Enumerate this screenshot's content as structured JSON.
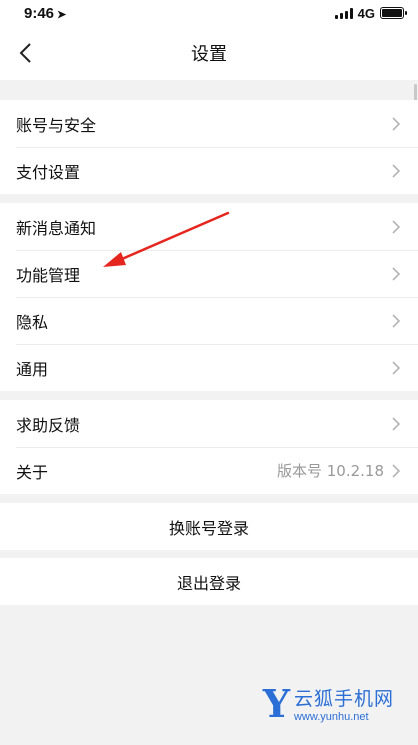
{
  "status_bar": {
    "time": "9:46",
    "location_icon": "location-arrow-icon",
    "network": "4G"
  },
  "nav": {
    "title": "设置"
  },
  "sections": [
    {
      "items": [
        {
          "label": "账号与安全"
        },
        {
          "label": "支付设置"
        }
      ]
    },
    {
      "items": [
        {
          "label": "新消息通知"
        },
        {
          "label": "功能管理"
        },
        {
          "label": "隐私"
        },
        {
          "label": "通用"
        }
      ]
    },
    {
      "items": [
        {
          "label": "求助反馈"
        },
        {
          "label": "关于",
          "value": "版本号 10.2.18"
        }
      ]
    }
  ],
  "actions": {
    "switch_account": "换账号登录",
    "logout": "退出登录"
  },
  "annotation": {
    "color": "#e5261f"
  },
  "watermark": {
    "logo": "Y",
    "name": "云狐手机网",
    "url": "www.yunhu.net"
  },
  "colors": {
    "accent": "#2b6fd6",
    "background": "#f2f2f2"
  }
}
